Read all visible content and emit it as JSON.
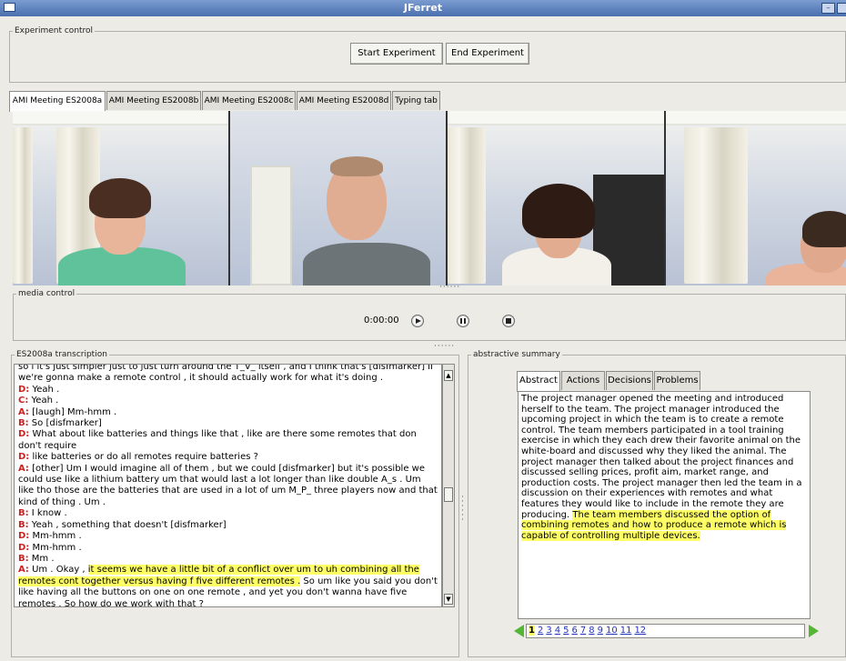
{
  "window": {
    "title": "JFerret"
  },
  "experiment_control": {
    "label": "Experiment control",
    "start_label": "Start Experiment",
    "end_label": "End Experiment"
  },
  "meeting_tabs": [
    {
      "label": "AMI Meeting ES2008a",
      "active": true
    },
    {
      "label": "AMI Meeting ES2008b",
      "active": false
    },
    {
      "label": "AMI Meeting ES2008c",
      "active": false
    },
    {
      "label": "AMI Meeting ES2008d",
      "active": false
    },
    {
      "label": "Typing tab",
      "active": false
    }
  ],
  "media_control": {
    "label": "media control",
    "time": "0:00:00",
    "buttons": [
      "play-icon",
      "pause-icon",
      "stop-icon"
    ]
  },
  "transcription": {
    "label": "ES2008a transcription",
    "lines": [
      {
        "speaker": "",
        "text": "so i it's just simpler just to just turn around the T_V_ itself , and I think that's [disfmarker] if we're gonna make a remote control , it should actually work for what it's doing ."
      },
      {
        "speaker": "D:",
        "text": " Yeah ."
      },
      {
        "speaker": "C:",
        "text": " Yeah ."
      },
      {
        "speaker": "A:",
        "text": " [laugh] Mm-hmm ."
      },
      {
        "speaker": "B:",
        "text": " So [disfmarker]"
      },
      {
        "speaker": "D:",
        "text": " What about like batteries and things like that , like are there some remotes that don don't require"
      },
      {
        "speaker": "D:",
        "text": " like batteries or do all remotes require batteries ?"
      },
      {
        "speaker": "A:",
        "text": " [other] Um I would imagine all of them , but we could [disfmarker] but it's possible we could use like a lithium battery um that would last a lot longer than like double A_s . Um like tho those are the batteries that are used in a lot of um M_P_ three players now and that kind of thing . Um ."
      },
      {
        "speaker": "B:",
        "text": " I know ."
      },
      {
        "speaker": "B:",
        "text": " Yeah , something that doesn't [disfmarker]"
      },
      {
        "speaker": "D:",
        "text": " Mm-hmm ."
      },
      {
        "speaker": "D:",
        "text": " Mm-hmm ."
      },
      {
        "speaker": "B:",
        "text": " Mm ."
      }
    ],
    "last_line": {
      "speaker": "A:",
      "prefix": " Um . Okay , ",
      "highlight": "it seems we have a little bit of a conflict over um to uh combining all the remotes cont together versus having f five different remotes .",
      "suffix": " So um like you said you don't like having all the buttons on one on one remote , and yet you don't wanna have five remotes . So how do we work with that ?"
    }
  },
  "summary": {
    "label": "abstractive summary",
    "tabs": [
      {
        "label": "Abstract",
        "active": true
      },
      {
        "label": "Actions",
        "active": false
      },
      {
        "label": "Decisions",
        "active": false
      },
      {
        "label": "Problems",
        "active": false
      }
    ],
    "text": "The project manager opened the meeting and introduced herself to the team. The project manager introduced the upcoming project in which the team is to create a remote control. The team members participated in a tool training exercise in which they each drew their favorite animal on the white-board and discussed why they liked the animal. The project manager then talked about the project finances and discussed selling prices, profit aim, market range, and production costs. The project manager then led the team in a discussion on their experiences with remotes and what features they would like to include in the remote they are producing. ",
    "highlight": "The team members discussed the option of combining remotes and how to produce a remote which is capable of controlling multiple devices.",
    "pages": [
      "1",
      "2",
      "3",
      "4",
      "5",
      "6",
      "7",
      "8",
      "9",
      "10",
      "11",
      "12"
    ],
    "current_page": "1"
  },
  "colors": {
    "highlight": "#ffff66",
    "speaker": "#cc2222",
    "link": "#2233bb",
    "nav_arrow": "#55b535"
  }
}
